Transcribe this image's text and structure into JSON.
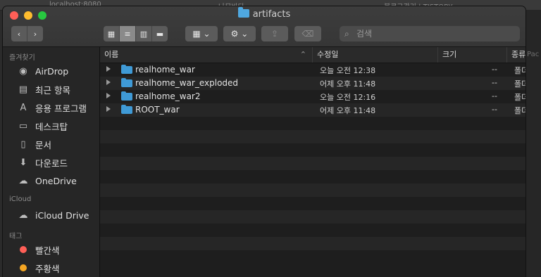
{
  "background": {
    "tabs": [
      "localhost:8080",
      "나무바다",
      "블로그관리 | TISTORY"
    ],
    "side_text": "Pac"
  },
  "window": {
    "title": "artifacts",
    "search_placeholder": "검색"
  },
  "sidebar": {
    "sections": [
      {
        "header": "즐겨찾기",
        "items": [
          {
            "label": "AirDrop",
            "icon": "airdrop-icon",
            "glyph": "◉"
          },
          {
            "label": "최근 항목",
            "icon": "recents-icon",
            "glyph": "▤"
          },
          {
            "label": "응용 프로그램",
            "icon": "applications-icon",
            "glyph": "A"
          },
          {
            "label": "데스크탑",
            "icon": "desktop-icon",
            "glyph": "▭"
          },
          {
            "label": "문서",
            "icon": "documents-icon",
            "glyph": "▯"
          },
          {
            "label": "다운로드",
            "icon": "downloads-icon",
            "glyph": "⬇"
          },
          {
            "label": "OneDrive",
            "icon": "cloud-icon",
            "glyph": "☁"
          }
        ]
      },
      {
        "header": "iCloud",
        "items": [
          {
            "label": "iCloud Drive",
            "icon": "cloud-icon",
            "glyph": "☁"
          }
        ]
      },
      {
        "header": "태그",
        "items": [
          {
            "label": "빨간색",
            "icon": "red-tag-icon",
            "color": "#ff5f57"
          },
          {
            "label": "주황색",
            "icon": "orange-tag-icon",
            "color": "#f5a623"
          }
        ]
      }
    ]
  },
  "columns": {
    "name": "이름",
    "date": "수정일",
    "size": "크기",
    "kind": "종류"
  },
  "files": [
    {
      "name": "realhome_war",
      "date": "오늘 오전 12:38",
      "size": "--",
      "kind": "폴더"
    },
    {
      "name": "realhome_war_exploded",
      "date": "어제 오후 11:48",
      "size": "--",
      "kind": "폴더"
    },
    {
      "name": "realhome_war2",
      "date": "오늘 오전 12:16",
      "size": "--",
      "kind": "폴더"
    },
    {
      "name": "ROOT_war",
      "date": "어제 오후 11:48",
      "size": "--",
      "kind": "폴더"
    }
  ],
  "empty_rows": 11,
  "colors": {
    "folder": "#3f9ad6",
    "close": "#ff5f57",
    "minimize": "#febc2e",
    "maximize": "#28c840"
  }
}
